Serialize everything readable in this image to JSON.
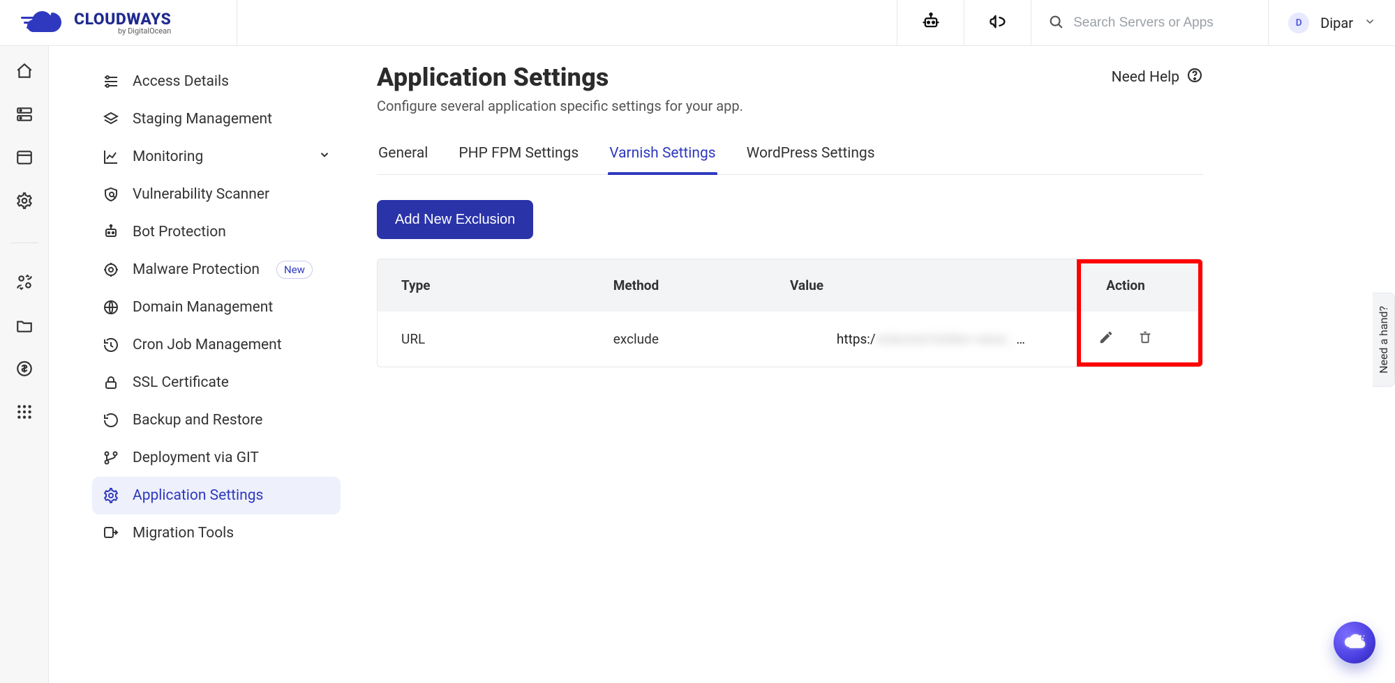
{
  "brand": {
    "name": "CLOUDWAYS",
    "by": "by DigitalOcean"
  },
  "header": {
    "search_placeholder": "Search Servers or Apps",
    "user_initial": "D",
    "user_name": "Dipar"
  },
  "rail": [
    {
      "name": "home-icon"
    },
    {
      "name": "server-icon"
    },
    {
      "name": "window-icon"
    },
    {
      "name": "gear-outline-icon"
    }
  ],
  "rail2": [
    {
      "name": "people-switch-icon"
    },
    {
      "name": "folder-icon"
    },
    {
      "name": "money-icon"
    },
    {
      "name": "grid-icon"
    }
  ],
  "sidebar": {
    "items": [
      {
        "label": "Access Details",
        "icon": "tune-icon"
      },
      {
        "label": "Staging Management",
        "icon": "layers-icon"
      },
      {
        "label": "Monitoring",
        "icon": "chart-icon",
        "chevron": true
      },
      {
        "label": "Vulnerability Scanner",
        "icon": "shield-scan-icon"
      },
      {
        "label": "Bot Protection",
        "icon": "robot-icon"
      },
      {
        "label": "Malware Protection",
        "icon": "target-icon",
        "badge": "New"
      },
      {
        "label": "Domain Management",
        "icon": "www-icon"
      },
      {
        "label": "Cron Job Management",
        "icon": "history-icon"
      },
      {
        "label": "SSL Certificate",
        "icon": "lock-icon"
      },
      {
        "label": "Backup and Restore",
        "icon": "restore-icon"
      },
      {
        "label": "Deployment via GIT",
        "icon": "git-branch-icon"
      },
      {
        "label": "Application Settings",
        "icon": "gear-icon",
        "active": true
      },
      {
        "label": "Migration Tools",
        "icon": "migrate-icon"
      }
    ]
  },
  "page_title": "Application Settings",
  "page_subtitle": "Configure several application specific settings for your app.",
  "need_help": "Need Help",
  "tabs": [
    {
      "label": "General"
    },
    {
      "label": "PHP FPM Settings"
    },
    {
      "label": "Varnish Settings",
      "active": true
    },
    {
      "label": "WordPress Settings"
    }
  ],
  "buttons": {
    "add_exclusion": "Add New Exclusion"
  },
  "table": {
    "headers": {
      "type": "Type",
      "method": "Method",
      "value": "Value",
      "action": "Action"
    },
    "rows": [
      {
        "type": "URL",
        "method": "exclude",
        "value_prefix": "https:/",
        "value_hidden": "redacted-hidden-value...",
        "ellipsis": "…"
      }
    ]
  },
  "hand_tab": "Need a hand?",
  "colors": {
    "accent": "#2f39bf"
  }
}
